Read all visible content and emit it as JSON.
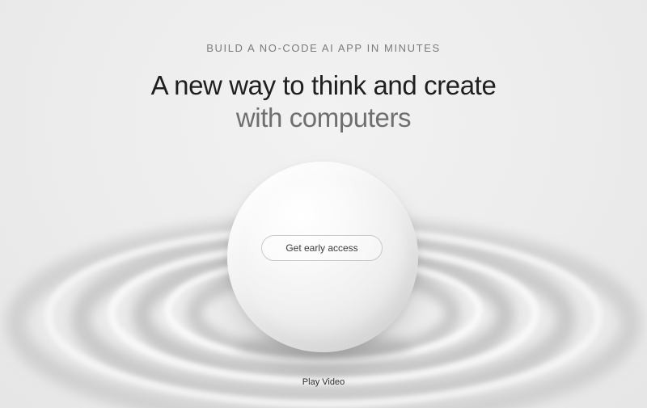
{
  "hero": {
    "eyebrow": "BUILD A NO-CODE AI APP IN MINUTES",
    "headline_line1": "A new way to think and create",
    "headline_line2": "with computers",
    "cta_label": "Get early access",
    "play_label": "Play Video"
  },
  "colors": {
    "background": "#ececec",
    "headline_primary": "#1f1f1f",
    "headline_secondary": "#6f6f6f",
    "eyebrow": "#7b7b7b"
  }
}
